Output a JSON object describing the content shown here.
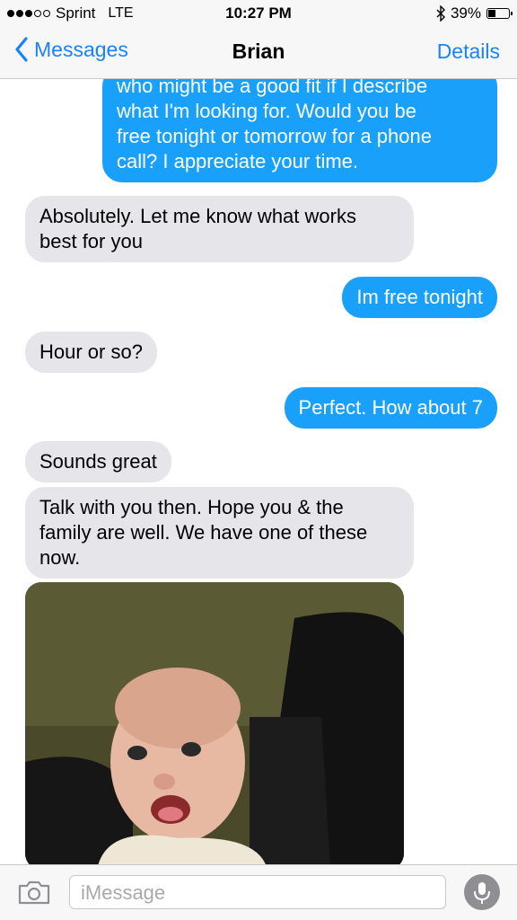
{
  "status": {
    "carrier": "Sprint",
    "network": "LTE",
    "time": "10:27 PM",
    "battery": "39%",
    "battery_level": 0.39,
    "signal_bars": 3
  },
  "nav": {
    "back_label": "Messages",
    "title": "Brian",
    "details_label": "Details"
  },
  "messages": [
    {
      "from": "me",
      "lines": [
        "who might be a good fit if I describe",
        "what I'm looking for. Would you be",
        "free tonight or tomorrow for a phone",
        "call? I appreciate your time."
      ]
    },
    {
      "from": "them",
      "lines": [
        "Absolutely.  Let me know what works",
        "best for you"
      ]
    },
    {
      "from": "me",
      "lines": [
        "Im free tonight"
      ]
    },
    {
      "from": "them",
      "lines": [
        "Hour or so?"
      ]
    },
    {
      "from": "me",
      "lines": [
        "Perfect. How about 7"
      ]
    },
    {
      "from": "them",
      "lines": [
        "Sounds great"
      ]
    },
    {
      "from": "them",
      "lines": [
        "Talk with you then. Hope you & the",
        "family are well. We have one of these",
        "now."
      ]
    }
  ],
  "photo": {
    "subject": "smiling baby photo"
  },
  "compose": {
    "placeholder": "iMessage"
  },
  "icons": {
    "back": "chevron-left-icon",
    "bluetooth": "bluetooth-icon",
    "camera": "camera-icon",
    "mic": "microphone-icon"
  },
  "colors": {
    "accent": "#1a82fb",
    "sent_bubble": "#18a0fb",
    "received_bubble": "#e5e5ea"
  }
}
